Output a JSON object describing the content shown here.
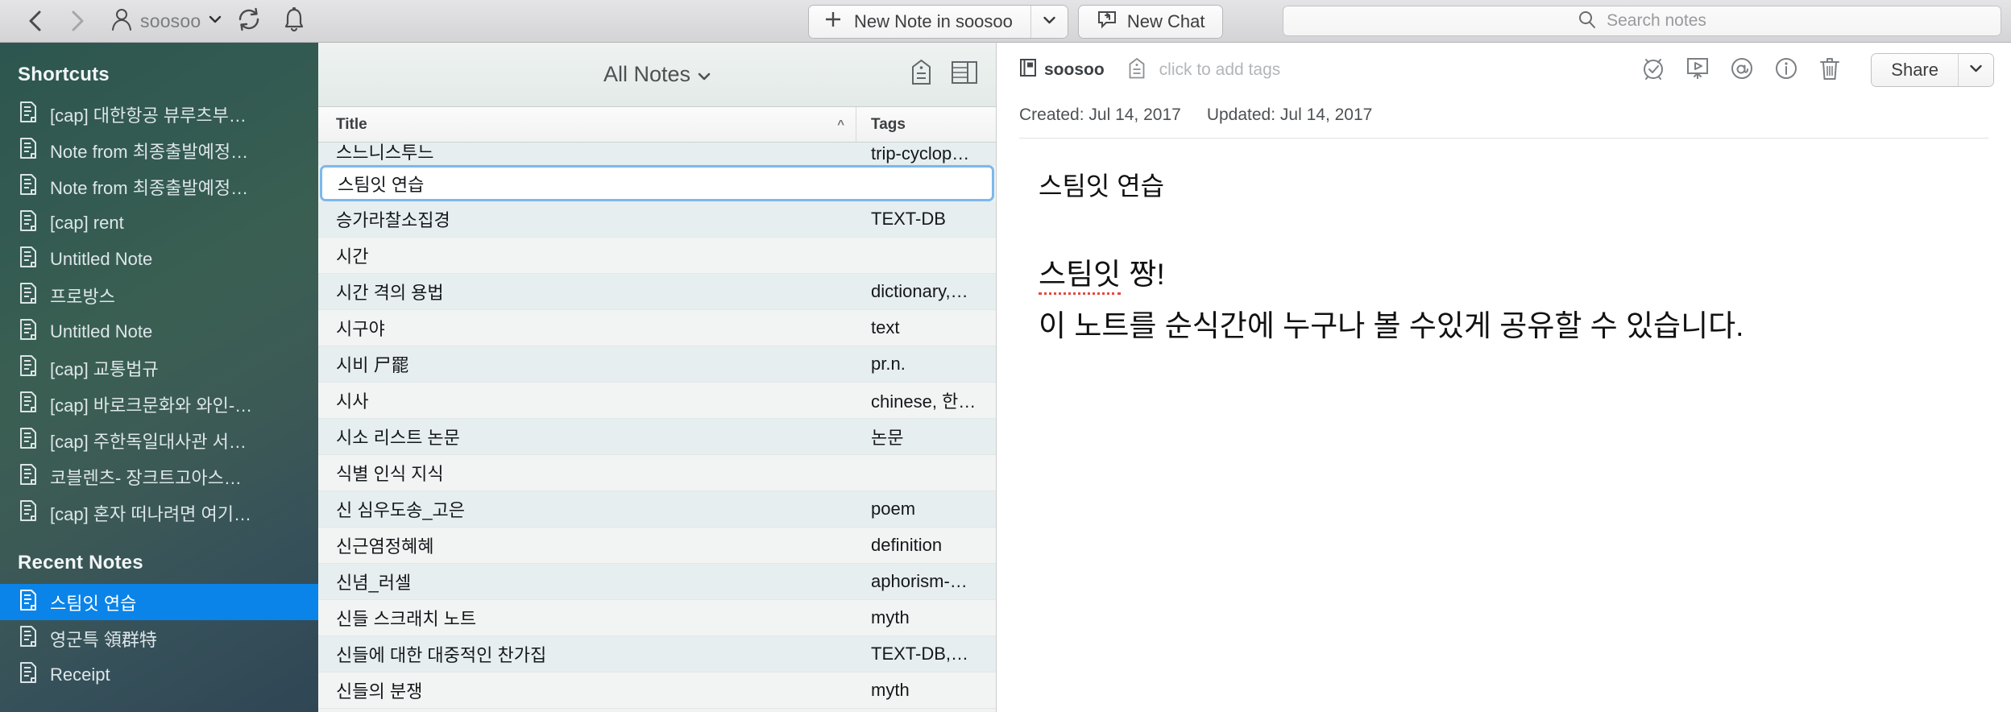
{
  "toolbar": {
    "back_icon": "chevron-left-icon",
    "forward_icon": "chevron-right-icon",
    "account_name": "soosoo",
    "account_caret": "⌄",
    "sync_icon": "sync-icon",
    "bell_icon": "bell-icon",
    "new_note_label": "New Note in soosoo",
    "new_note_plus": "+",
    "new_note_caret": "⌄",
    "new_chat_label": "New Chat",
    "search_placeholder": "Search notes"
  },
  "sidebar": {
    "shortcuts_header": "Shortcuts",
    "shortcuts": [
      {
        "label": "[cap] 대한항공 뷰루츠부…"
      },
      {
        "label": "Note from 최종출발예정…"
      },
      {
        "label": "Note from 최종출발예정…"
      },
      {
        "label": "[cap] rent"
      },
      {
        "label": "Untitled Note"
      },
      {
        "label": "프로방스"
      },
      {
        "label": "Untitled Note"
      },
      {
        "label": "[cap] 교통법규"
      },
      {
        "label": "[cap] 바로크문화와 와인-…"
      },
      {
        "label": "[cap] 주한독일대사관 서…"
      },
      {
        "label": "코블렌츠- 장크트고아스…"
      },
      {
        "label": "[cap] 혼자 떠나려면 여기…"
      }
    ],
    "recent_header": "Recent Notes",
    "recent": [
      {
        "label": "스팀잇 연습",
        "selected": true
      },
      {
        "label": "영군특 領群特",
        "selected": false
      },
      {
        "label": "Receipt",
        "selected": false
      }
    ],
    "selection_color": "#0a84e8"
  },
  "note_list": {
    "title": "All Notes",
    "title_caret": "⌄",
    "tag_icon": "tag-icon",
    "layout_icon": "list-layout-icon",
    "columns": {
      "title": "Title",
      "tags": "Tags"
    },
    "sort_caret": "^",
    "rows": [
      {
        "title": "스느니스투느",
        "tags": "trip-cyclop…",
        "clipped": true,
        "selected": false
      },
      {
        "title": "스팀잇 연습",
        "tags": "",
        "clipped": false,
        "selected": true
      },
      {
        "title": "승가라찰소집경",
        "tags": "TEXT-DB",
        "clipped": false,
        "selected": false
      },
      {
        "title": "시간",
        "tags": "",
        "clipped": false,
        "selected": false
      },
      {
        "title": "시간 격의 용법",
        "tags": "dictionary,…",
        "clipped": false,
        "selected": false
      },
      {
        "title": "시구야",
        "tags": "text",
        "clipped": false,
        "selected": false
      },
      {
        "title": "시비 尸罷",
        "tags": "pr.n.",
        "clipped": false,
        "selected": false
      },
      {
        "title": "시사",
        "tags": "chinese, 한…",
        "clipped": false,
        "selected": false
      },
      {
        "title": "시소 리스트 논문",
        "tags": "논문",
        "clipped": false,
        "selected": false
      },
      {
        "title": "식별 인식 지식",
        "tags": "",
        "clipped": false,
        "selected": false
      },
      {
        "title": "신 심우도송_고은",
        "tags": "poem",
        "clipped": false,
        "selected": false
      },
      {
        "title": "신근염정혜혜",
        "tags": "definition",
        "clipped": false,
        "selected": false
      },
      {
        "title": "신념_러셀",
        "tags": "aphorism-…",
        "clipped": false,
        "selected": false
      },
      {
        "title": "신들 스크래치 노트",
        "tags": "myth",
        "clipped": false,
        "selected": false
      },
      {
        "title": "신들에 대한 대중적인 찬가집",
        "tags": "TEXT-DB,…",
        "clipped": false,
        "selected": false
      },
      {
        "title": "신들의 분쟁",
        "tags": "myth",
        "clipped": false,
        "selected": false
      }
    ]
  },
  "editor": {
    "notebook": "soosoo",
    "notebook_icon": "notebook-icon",
    "tag_icon": "tag-icon",
    "tag_placeholder": "click to add tags",
    "icons": {
      "reminder": "alarm-check-icon",
      "present": "presentation-icon",
      "annotate": "at-circle-icon",
      "info": "info-circle-icon",
      "delete": "trash-icon"
    },
    "share_label": "Share",
    "share_caret": "⌄",
    "created_label": "Created:",
    "created_value": "Jul 14, 2017",
    "updated_label": "Updated:",
    "updated_value": "Jul 14, 2017",
    "note_title": "스팀잇 연습",
    "heading_spell": "스팀잇",
    "heading_rest": " 짱!",
    "paragraph": "이 노트를 순식간에 누구나 볼 수있게 공유할 수 있습니다."
  }
}
